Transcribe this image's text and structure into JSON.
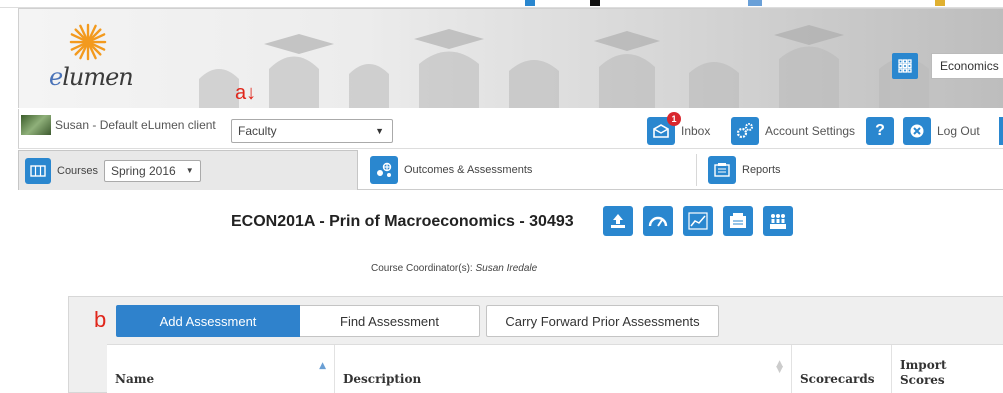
{
  "header": {
    "logo_text_e": "e",
    "logo_text_rest": "lumen",
    "department": "Economics"
  },
  "annotations": {
    "a": "a↓",
    "b": "b"
  },
  "userbar": {
    "user_label": "Susan - Default eLumen client",
    "role": "Faculty",
    "inbox_label": "Inbox",
    "inbox_badge": "1",
    "account_settings_label": "Account Settings",
    "help_label": "?",
    "logout_label": "Log Out"
  },
  "tabs": {
    "courses_label": "Courses",
    "term": "Spring 2016",
    "outcomes_label": "Outcomes & Assessments",
    "reports_label": "Reports"
  },
  "course": {
    "title": "ECON201A - Prin of Macroeconomics - 30493",
    "coordinator_prefix": "Course Coordinator(s): ",
    "coordinator_name": "Susan Iredale"
  },
  "assessments": {
    "add_label": "Add Assessment",
    "find_label": "Find Assessment",
    "carry_label": "Carry Forward Prior Assessments",
    "columns": {
      "name": "Name",
      "description": "Description",
      "scorecards": "Scorecards",
      "import_scores": "Import Scores"
    }
  },
  "colors": {
    "accent": "#2a87cf",
    "primary_button": "#2f82cc",
    "badge": "#d9272e",
    "annotation": "#e0261b"
  }
}
